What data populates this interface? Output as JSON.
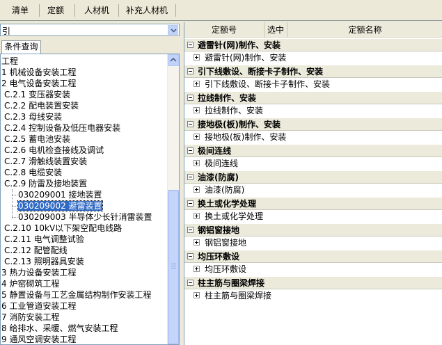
{
  "tabs": [
    "清单",
    "定额",
    "人材机",
    "补充人材机"
  ],
  "left": {
    "combo_value": "引",
    "condition_tab": "条件查询",
    "tree": [
      {
        "text": "工程",
        "indent": 0
      },
      {
        "text": "1 机械设备安装工程",
        "indent": 0
      },
      {
        "text": "2 电气设备安装工程",
        "indent": 0
      },
      {
        "text": "C.2.1 变压器安装",
        "indent": 1
      },
      {
        "text": "C.2.2 配电装置安装",
        "indent": 1
      },
      {
        "text": "C.2.3 母线安装",
        "indent": 1
      },
      {
        "text": "C.2.4 控制设备及低压电器安装",
        "indent": 1
      },
      {
        "text": "C.2.5 蓄电池安装",
        "indent": 1
      },
      {
        "text": "C.2.6 电机检查接线及调试",
        "indent": 1
      },
      {
        "text": "C.2.7 滑触线装置安装",
        "indent": 1
      },
      {
        "text": "C.2.8 电缆安装",
        "indent": 1
      },
      {
        "text": "C.2.9 防雷及接地装置",
        "indent": 1
      },
      {
        "text": "030209001  接地装置",
        "indent": 2
      },
      {
        "text": "030209002  避雷装置",
        "indent": 2,
        "selected": true
      },
      {
        "text": "030209003  半导体少长针消雷装置",
        "indent": 2
      },
      {
        "text": "C.2.10 10kV以下架空配电线路",
        "indent": 1
      },
      {
        "text": "C.2.11 电气调整试验",
        "indent": 1
      },
      {
        "text": "C.2.12 配管配线",
        "indent": 1
      },
      {
        "text": "C.2.13 照明器具安装",
        "indent": 1
      },
      {
        "text": "3 热力设备安装工程",
        "indent": 0
      },
      {
        "text": "4 炉窑砌筑工程",
        "indent": 0
      },
      {
        "text": "5 静置设备与工艺金属结构制作安装工程",
        "indent": 0
      },
      {
        "text": "6 工业管道安装工程",
        "indent": 0
      },
      {
        "text": "7 消防安装工程",
        "indent": 0
      },
      {
        "text": "8 给排水、采暖、燃气安装工程",
        "indent": 0
      },
      {
        "text": "9 通风空调安装工程",
        "indent": 0
      }
    ]
  },
  "grid": {
    "columns": [
      "定额号",
      "选中",
      "定额名称"
    ],
    "groups": [
      {
        "title": "避雷针(网)制作、安装",
        "item": "避雷针(网)制作、安装"
      },
      {
        "title": "引下线敷设、断接卡子制作、安装",
        "item": "引下线敷设、断接卡子制作、安装"
      },
      {
        "title": "拉线制作、安装",
        "item": "拉线制作、安装"
      },
      {
        "title": "接地极(板)制作、安装",
        "item": "接地极(板)制作、安装"
      },
      {
        "title": "极间连线",
        "item": "极间连线"
      },
      {
        "title": "油漆(防腐)",
        "item": "油漆(防腐)"
      },
      {
        "title": "换土或化学处理",
        "item": "换土或化学处理"
      },
      {
        "title": "钢铝窗接地",
        "item": "钢铝窗接地"
      },
      {
        "title": "均压环敷设",
        "item": "均压环敷设"
      },
      {
        "title": "柱主筋与圈梁焊接",
        "item": "柱主筋与圈梁焊接"
      }
    ]
  },
  "colors": {
    "selection": "#316ac5",
    "header": "#ebeadb",
    "border": "#7f9db9"
  }
}
